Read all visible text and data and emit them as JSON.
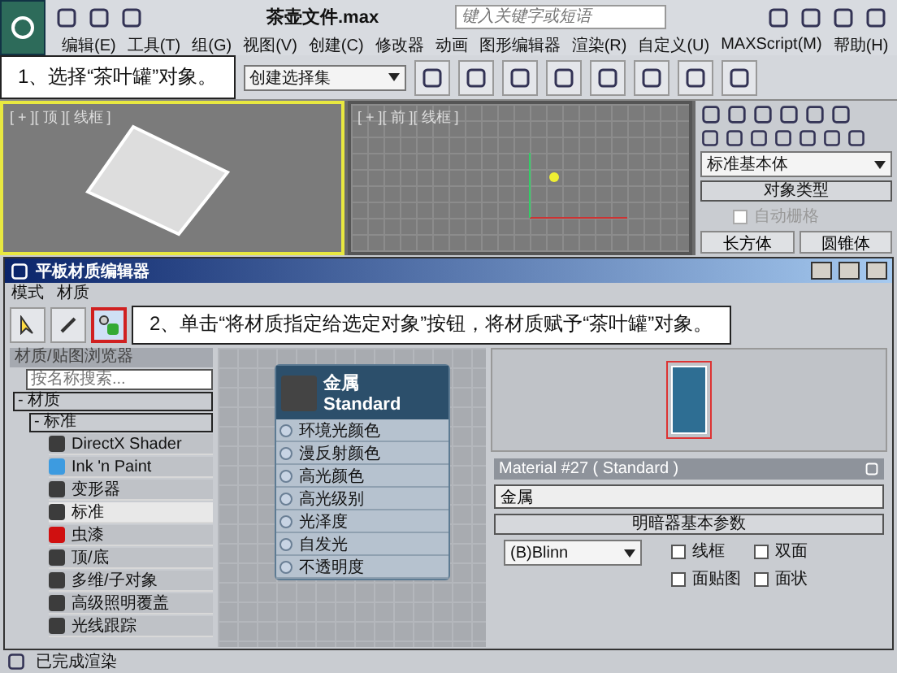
{
  "app": {
    "title": "茶壶文件.max",
    "search": {
      "placeholder": "键入关键字或短语"
    }
  },
  "menu": [
    "编辑(E)",
    "工具(T)",
    "组(G)",
    "视图(V)",
    "创建(C)",
    "修改器",
    "动画",
    "图形编辑器",
    "渲染(R)",
    "自定义(U)",
    "MAXScript(M)",
    "帮助(H)"
  ],
  "toolbar": {
    "callout": "1、选择“茶叶罐”对象。",
    "selection_set": "创建选择集"
  },
  "viewports": [
    {
      "label": "[ + ][ 顶 ][ 线框 ]",
      "active": true
    },
    {
      "label": "[ + ][ 前 ][ 线框 ]",
      "active": false
    }
  ],
  "command_panel": {
    "category": "标准基本体",
    "rollout": "对象类型",
    "autogrid": {
      "label": "自动栅格",
      "checked": false,
      "disabled": true
    },
    "buttons": [
      "长方体",
      "圆锥体"
    ]
  },
  "material_editor": {
    "title": "平板材质编辑器",
    "menu": [
      "模式",
      "材质"
    ],
    "callout": "2、单击“将材质指定给选定对象”按钮，将材质赋予“茶叶罐”对象。",
    "browser": {
      "title": "材质/贴图浏览器",
      "search": {
        "placeholder": "按名称搜索..."
      },
      "group": "- 材质",
      "subgroup": "- 标准",
      "items": [
        {
          "label": "DirectX Shader",
          "color": "#3c3c3c",
          "selected": false
        },
        {
          "label": "Ink 'n Paint",
          "color": "#3d9be0",
          "selected": false
        },
        {
          "label": "变形器",
          "color": "#3c3c3c",
          "selected": false
        },
        {
          "label": "标准",
          "color": "#3c3c3c",
          "selected": true
        },
        {
          "label": "虫漆",
          "color": "#d01010",
          "selected": false
        },
        {
          "label": "顶/底",
          "color": "#3c3c3c",
          "selected": false
        },
        {
          "label": "多维/子对象",
          "color": "#3c3c3c",
          "selected": false
        },
        {
          "label": "高级照明覆盖",
          "color": "#3c3c3c",
          "selected": false
        },
        {
          "label": "光线跟踪",
          "color": "#3c3c3c",
          "selected": false
        }
      ]
    },
    "node": {
      "name": "金属",
      "type": "Standard",
      "slots": [
        "环境光颜色",
        "漫反射颜色",
        "高光颜色",
        "高光级别",
        "光泽度",
        "自发光",
        "不透明度"
      ]
    },
    "params": {
      "title": "Material #27  ( Standard )",
      "name": "金属",
      "rollout": "明暗器基本参数",
      "shader": "(B)Blinn",
      "options": [
        {
          "label": "线框",
          "checked": false
        },
        {
          "label": "双面",
          "checked": false
        },
        {
          "label": "面贴图",
          "checked": false
        },
        {
          "label": "面状",
          "checked": false
        }
      ]
    }
  },
  "status_bar": "已完成渲染"
}
